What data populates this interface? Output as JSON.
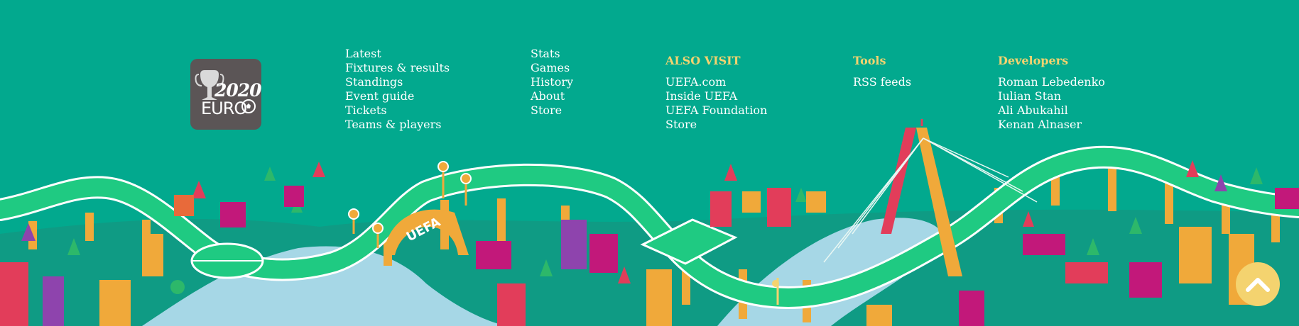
{
  "logo": {
    "year": "2020",
    "word": "EURO"
  },
  "nav_primary": [
    "Latest",
    "Fixtures & results",
    "Standings",
    "Event guide",
    "Tickets",
    "Teams & players"
  ],
  "nav_secondary": [
    "Stats",
    "Games",
    "History",
    "About",
    "Store"
  ],
  "also_visit": {
    "heading": "ALSO VISIT",
    "links": [
      "UEFA.com",
      "Inside UEFA",
      "UEFA Foundation",
      "Store"
    ]
  },
  "tools": {
    "heading": "Tools",
    "links": [
      "RSS feeds"
    ]
  },
  "developers": {
    "heading": "Developers",
    "names": [
      "Roman Lebedenko",
      "Iulian Stan",
      "Ali Abukahil",
      "Kenan Alnaser"
    ]
  },
  "illustration": {
    "arch_text": "UEFA"
  },
  "icons": {
    "scroll_top": "chevron-up-icon",
    "logo": "trophy-icon",
    "ball": "football-icon"
  },
  "colors": {
    "background": "#02a98e",
    "accent": "#f4d36f",
    "road": "#1fca82",
    "river": "#a6d7e6",
    "logo_bg": "#5b5556"
  }
}
